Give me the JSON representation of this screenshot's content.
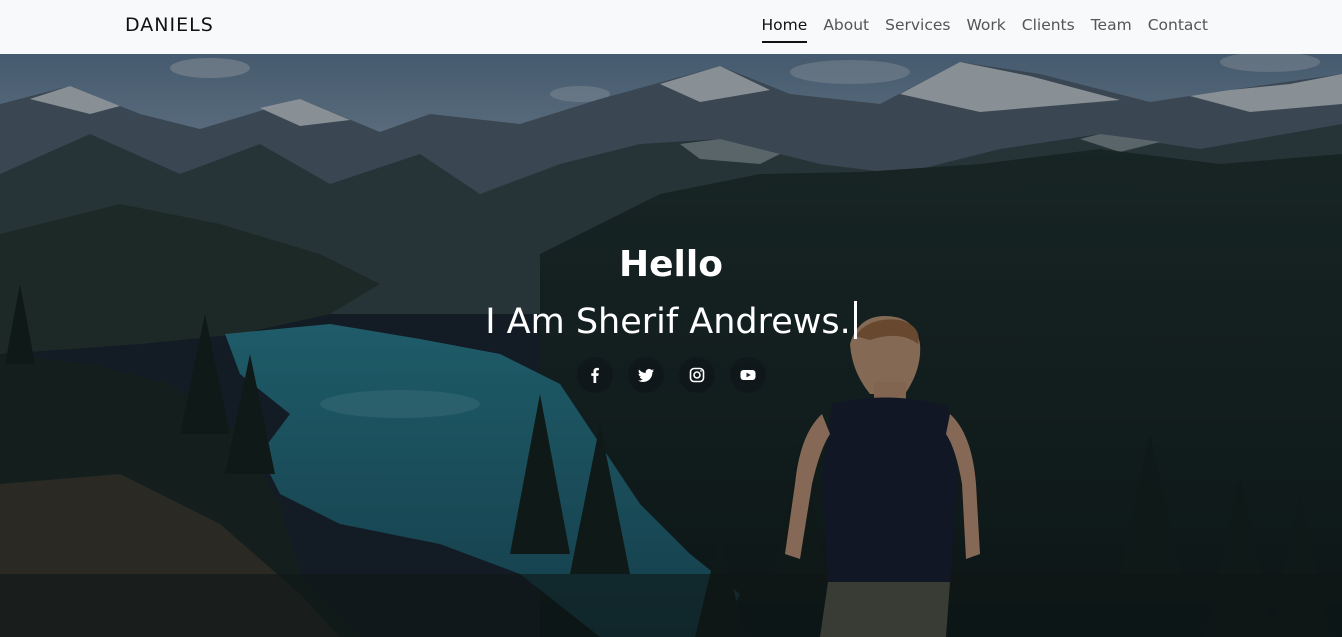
{
  "brand": "DANIELS",
  "nav": {
    "items": [
      {
        "label": "Home",
        "active": true
      },
      {
        "label": "About"
      },
      {
        "label": "Services"
      },
      {
        "label": "Work"
      },
      {
        "label": "Clients"
      },
      {
        "label": "Team"
      },
      {
        "label": "Contact"
      }
    ]
  },
  "hero": {
    "title": "Hello",
    "subtitle": "I Am Sherif Andrews.",
    "background": "mountain-lake-landscape-photo",
    "socials": [
      {
        "icon": "facebook-icon"
      },
      {
        "icon": "twitter-icon"
      },
      {
        "icon": "instagram-icon"
      },
      {
        "icon": "youtube-icon"
      }
    ]
  },
  "colors": {
    "navbar_bg": "#f8f9fb",
    "nav_text": "#555555",
    "nav_active": "#111111",
    "hero_text": "#ffffff"
  }
}
